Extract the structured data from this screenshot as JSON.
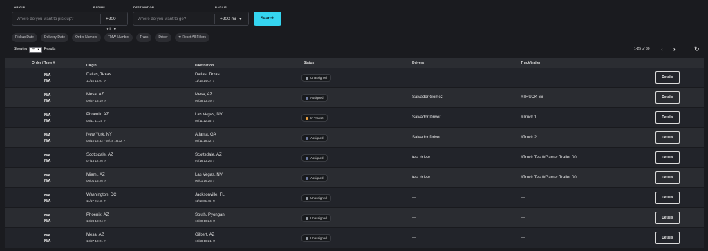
{
  "search": {
    "origin_label": "ORIGIN",
    "origin_placeholder": "Where do you want to pick up?",
    "origin_radius_label": "RADIUS",
    "origin_radius_value": "+200 mi",
    "destination_label": "DESTINATION",
    "destination_placeholder": "Where do you want to go?",
    "destination_radius_label": "RADIUS",
    "destination_radius_value": "+200 mi",
    "search_button": "Search"
  },
  "filters": [
    "Pickup Date",
    "Delivery Date",
    "Order Number",
    "TMW Number",
    "Truck",
    "Driver",
    "Reset All Filters"
  ],
  "listing": {
    "showing_label": "Showing",
    "page_size": "25",
    "results_label": "Results",
    "range": "1-25 of 30"
  },
  "icons": {
    "chevron": "chevron-down-icon",
    "prev": "chevron-left-icon",
    "next": "chevron-right-icon",
    "refresh": "refresh-icon",
    "reset": "reset-icon"
  },
  "colors": {
    "accent": "#35d5f0",
    "unassigned": "#9aa0aa",
    "assigned": "#6f7ea6",
    "in_transit": "#f2a33a"
  },
  "table": {
    "headers": [
      "Order / Tmw #",
      "Origin",
      "Destination",
      "Status",
      "Drivers",
      "Truck/trailer"
    ],
    "details_label": "Details",
    "rows": [
      {
        "order": "N/A",
        "tmw": "N/A",
        "origin": "Dallas, Texas",
        "origin_time": "11/14 14:07",
        "origin_mark": "✓",
        "dest": "Dallas, Texas",
        "dest_time": "11/15 14:07",
        "dest_mark": "✓",
        "status": "Unassigned",
        "status_key": "unassigned",
        "driver": "---",
        "truck": "---"
      },
      {
        "order": "N/A",
        "tmw": "N/A",
        "origin": "Mesa, AZ",
        "origin_time": "09/27 13:19",
        "origin_mark": "✓",
        "dest": "Mesa, AZ",
        "dest_time": "09/28 13:19",
        "dest_mark": "✓",
        "status": "Assigned",
        "status_key": "assigned",
        "driver": "Salvador Gomez",
        "truck": "#TRUCK 66"
      },
      {
        "order": "N/A",
        "tmw": "N/A",
        "origin": "Phoenix, AZ",
        "origin_time": "08/11 11:25",
        "origin_mark": "✓",
        "dest": "Las Vegas, NV",
        "dest_time": "08/11 12:25",
        "dest_mark": "✓",
        "status": "In Transit",
        "status_key": "in_transit",
        "driver": "Salvador Driver",
        "truck": "#Truck 1"
      },
      {
        "order": "N/A",
        "tmw": "N/A",
        "origin": "New York, NY",
        "origin_time": "08/10 18:32 - 08/18 18:32",
        "origin_mark": "✓",
        "dest": "Atlanta, GA",
        "dest_time": "08/11 18:32",
        "dest_mark": "✓",
        "status": "Assigned",
        "status_key": "assigned",
        "driver": "Salvador Driver",
        "truck": "#Truck 2"
      },
      {
        "order": "N/A",
        "tmw": "N/A",
        "origin": "Scottsdale, AZ",
        "origin_time": "07/16 12:26",
        "origin_mark": "✓",
        "dest": "Scottsdale, AZ",
        "dest_time": "07/16 13:26",
        "dest_mark": "✓",
        "status": "Assigned",
        "status_key": "assigned",
        "driver": "test driver",
        "truck": "#Truck Test/#Gamer Trailer 00"
      },
      {
        "order": "N/A",
        "tmw": "N/A",
        "origin": "Miami, AZ",
        "origin_time": "06/01 15:26",
        "origin_mark": "✓",
        "dest": "Las Vegas, NV",
        "dest_time": "06/01 16:26",
        "dest_mark": "✓",
        "status": "Assigned",
        "status_key": "assigned",
        "driver": "test driver",
        "truck": "#Truck Test/#Gamer Trailer 00"
      },
      {
        "order": "N/A",
        "tmw": "N/A",
        "origin": "Washington, DC",
        "origin_time": "11/17 01:46",
        "origin_mark": "✕",
        "dest": "Jacksonville, FL",
        "dest_time": "11/19 01:46",
        "dest_mark": "✕",
        "status": "Unassigned",
        "status_key": "unassigned",
        "driver": "---",
        "truck": "---"
      },
      {
        "order": "N/A",
        "tmw": "N/A",
        "origin": "Phoenix, AZ",
        "origin_time": "10/28 18:24",
        "origin_mark": "✕",
        "dest": "South, Pyongan",
        "dest_time": "10/30 10:24",
        "dest_mark": "✕",
        "status": "Unassigned",
        "status_key": "unassigned",
        "driver": "---",
        "truck": "---"
      },
      {
        "order": "N/A",
        "tmw": "N/A",
        "origin": "Mesa, AZ",
        "origin_time": "10/27 18:21",
        "origin_mark": "✕",
        "dest": "Gilbert, AZ",
        "dest_time": "10/28 18:21",
        "dest_mark": "✕",
        "status": "Unassigned",
        "status_key": "unassigned",
        "driver": "---",
        "truck": "---"
      }
    ]
  }
}
